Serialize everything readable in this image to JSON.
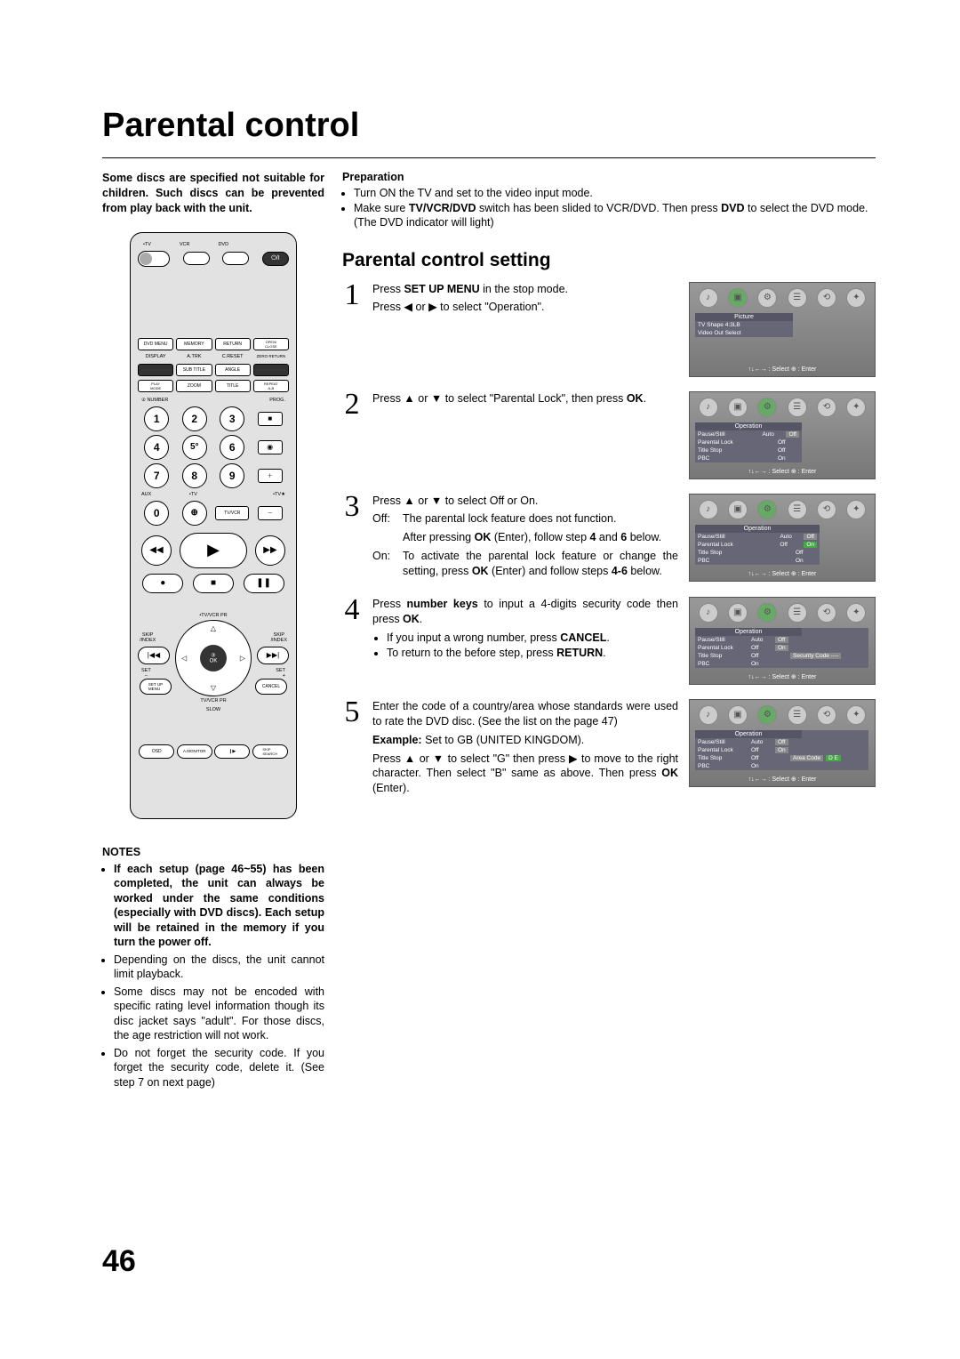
{
  "page": {
    "title": "Parental control",
    "number": "46"
  },
  "intro": "Some discs are specified not suitable for children. Such discs can be prevented from play back with the unit.",
  "remote": {
    "top_labels": {
      "tv": "•TV",
      "vcr": "VCR",
      "dvd": "DVD"
    },
    "power": "⏻/I",
    "row1": {
      "c1": "DVD MENU",
      "c2": "MEMORY",
      "c3": "RETURN",
      "c4": "OPEN/\nCLOSE"
    },
    "row2": {
      "c1": "DISPLAY",
      "c2": "A.TRK",
      "c3": "C.RESET",
      "c4": "ZERO RETURN"
    },
    "row3": {
      "c2": "SUB TITLE",
      "c3": "ANGLE"
    },
    "row4": {
      "c1": "PLAY\nMODE",
      "c2": "ZOOM",
      "c3": "TITLE",
      "c4": "REPEAT\nA-B"
    },
    "number_label": "② NUMBER",
    "prog_label": "PROG.",
    "numbers": [
      "1",
      "2",
      "3",
      "4",
      "5°",
      "6",
      "7",
      "8",
      "9",
      "0"
    ],
    "aux": "AUX",
    "tv_dot": "•TV",
    "tv_star": "•TV★",
    "input": "⊕",
    "tvvcr": "TV/VCR",
    "plus": "＋",
    "minus": "－",
    "rec_icon1": "■",
    "rec_icon2": "◉",
    "transport": {
      "rew": "◀◀",
      "play": "▶",
      "ff": "▶▶",
      "rec": "●",
      "stop": "■",
      "pause": "❚❚"
    },
    "skip": "SKIP\n/INDEX",
    "set_minus": "SET\n–",
    "set_plus": "SET\n+",
    "setup_menu": "SET UP\nMENU",
    "cancel": "CANCEL",
    "ok_label": "③\nOK",
    "arc_top": "•TV/VCR PR",
    "arc_bot": "TV/VCR PR",
    "slow": "SLOW",
    "osd": "OSD",
    "amonitor": "A.MONITOR",
    "skip_search": "SKIP\nSEARCH",
    "fwd_icon": "❙▶"
  },
  "notes": {
    "heading": "NOTES",
    "items": [
      {
        "bold": true,
        "text": "If each setup (page 46~55) has been completed, the unit can always be worked under the same conditions (especially with DVD discs). Each setup will be retained in the memory if you turn the power off."
      },
      {
        "bold": false,
        "text": "Depending on the discs, the unit cannot limit playback."
      },
      {
        "bold": false,
        "text": "Some discs may not be encoded with specific rating level information though its disc jacket says \"adult\". For those discs, the age restriction will not work."
      },
      {
        "bold": false,
        "text": "Do not forget the security code. If you forget the security code, delete it. (See step 7 on next page)"
      }
    ]
  },
  "preparation": {
    "heading": "Preparation",
    "items": [
      "Turn ON the TV and set to the video input mode.",
      "Make sure TV/VCR/DVD switch has been slided to VCR/DVD. Then press DVD to select the DVD mode. (The DVD indicator will light)"
    ]
  },
  "section_heading": "Parental control setting",
  "steps": {
    "s1": {
      "num": "1",
      "p1_a": "Press ",
      "p1_b": "SET UP MENU",
      "p1_c": " in the stop mode.",
      "p2": "Press ◀ or ▶ to select \"Operation\"."
    },
    "s2": {
      "num": "2",
      "p1_a": "Press ▲ or ▼ to select \"Parental Lock\", then press ",
      "p1_b": "OK",
      "p1_c": "."
    },
    "s3": {
      "num": "3",
      "p1": "Press ▲ or ▼ to select Off or On.",
      "off_label": "Off:",
      "off_a": "The parental lock feature does not function.",
      "off_b_a": "After pressing ",
      "off_b_b": "OK",
      "off_b_c": " (Enter), follow step ",
      "off_b_d": "4",
      "off_b_e": " and ",
      "off_b_f": "6",
      "off_b_g": " below.",
      "on_label": "On:",
      "on_a": "To activate the parental lock feature or change the setting, press ",
      "on_b": "OK",
      "on_c": " (Enter) and follow steps ",
      "on_d": "4-6",
      "on_e": " below."
    },
    "s4": {
      "num": "4",
      "p1_a": "Press ",
      "p1_b": "number keys",
      "p1_c": " to input a 4-digits security code then press ",
      "p1_d": "OK",
      "p1_e": ".",
      "b1_a": "If you input a wrong number, press ",
      "b1_b": "CANCEL",
      "b1_c": ".",
      "b2_a": "To return to the before step, press ",
      "b2_b": "RETURN",
      "b2_c": "."
    },
    "s5": {
      "num": "5",
      "p1": "Enter the code of a country/area whose standards were used to rate the DVD disc. (See the list on the page 47)",
      "p2_a": "Example:",
      "p2_b": " Set to GB (UNITED KINGDOM).",
      "p3_a": "Press ▲ or ▼ to select \"G\" then press ▶ to move to the right character. Then select \"B\" same as above. Then press ",
      "p3_b": "OK",
      "p3_c": " (Enter)."
    }
  },
  "screens": {
    "footer": "↑↓←→ : Select   ⊕ : Enter",
    "s1": {
      "panel_h": "Picture",
      "r1": "TV Shape 4:3LB",
      "r2": "Video Out Select"
    },
    "op": {
      "panel_h": "Operation",
      "r1k": "Pause/Still",
      "r1v": "Auto",
      "r2k": "Parental Lock",
      "r2v": "Off",
      "r3k": "Title Stop",
      "r3v": "Off",
      "r4k": "PBC",
      "r4v": "On"
    },
    "s2_box": "Off",
    "s3_box1": "Off",
    "s3_box2": "On",
    "s4_box1": "Off",
    "s4_box2": "On",
    "s4_extra": "Security Code ----",
    "s5_box1": "Off",
    "s5_box2": "On",
    "s5_extra_k": "Area Code",
    "s5_extra_v": "D E"
  }
}
